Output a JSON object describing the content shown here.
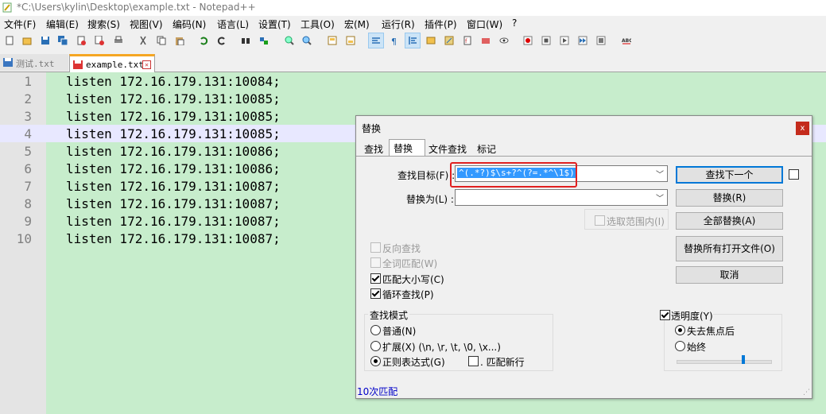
{
  "window": {
    "title": "*C:\\Users\\kylin\\Desktop\\example.txt - Notepad++"
  },
  "menu": [
    "文件(F)",
    "编辑(E)",
    "搜索(S)",
    "视图(V)",
    "编码(N)",
    "语言(L)",
    "设置(T)",
    "工具(O)",
    "宏(M)",
    "运行(R)",
    "插件(P)",
    "窗口(W)",
    "?"
  ],
  "toolbar": {
    "icons": [
      "new-file-icon",
      "open-file-icon",
      "save-icon",
      "save-all-icon",
      "close-icon",
      "close-all-icon",
      "print-icon",
      "cut-icon",
      "copy-icon",
      "paste-icon",
      "undo-icon",
      "redo-icon",
      "find-icon",
      "replace-icon",
      "zoom-in-icon",
      "zoom-out-icon",
      "sync-v-icon",
      "sync-h-icon",
      "word-wrap-icon",
      "all-chars-icon",
      "indent-guide-icon",
      "udl-icon",
      "doc-map-icon",
      "function-list-icon",
      "folder-as-workspace-icon",
      "monitor-icon",
      "record-macro-icon",
      "stop-record-icon",
      "play-macro-icon",
      "run-macro-multi-icon",
      "save-macro-icon",
      "spellcheck-icon"
    ]
  },
  "tabs": [
    {
      "label": "测试.txt",
      "active": false
    },
    {
      "label": "example.txt",
      "active": true
    }
  ],
  "editor": {
    "current_line": 4,
    "lines": [
      "listen 172.16.179.131:10084;",
      "listen 172.16.179.131:10085;",
      "listen 172.16.179.131:10085;",
      "listen 172.16.179.131:10085;",
      "listen 172.16.179.131:10086;",
      "listen 172.16.179.131:10086;",
      "listen 172.16.179.131:10087;",
      "listen 172.16.179.131:10087;",
      "listen 172.16.179.131:10087;",
      "listen 172.16.179.131:10087;"
    ],
    "background_color": "#c7edcc"
  },
  "dialog": {
    "title": "替换",
    "close_label": "x",
    "tabs": [
      "查找",
      "替换",
      "文件查找",
      "标记"
    ],
    "active_tab": "替换",
    "find_label": "查找目标(F) :",
    "find_value": "^(.*?)$\\s+?^(?=.*^\\1$)",
    "replace_label": "替换为(L) :",
    "replace_value": "",
    "in_selection": {
      "label": "选取范围内(I)",
      "checked": false,
      "enabled": false
    },
    "buttons": {
      "find_next": "查找下一个",
      "replace": "替换(R)",
      "replace_all": "全部替换(A)",
      "replace_all_open": "替换所有打开文件(O)",
      "cancel": "取消"
    },
    "options": {
      "backward": {
        "label": "反向查找",
        "checked": false,
        "enabled": false
      },
      "whole_word": {
        "label": "全词匹配(W)",
        "checked": false,
        "enabled": false
      },
      "match_case": {
        "label": "匹配大小写(C)",
        "checked": true,
        "enabled": true
      },
      "wrap": {
        "label": "循环查找(P)",
        "checked": true,
        "enabled": true
      }
    },
    "search_mode": {
      "title": "查找模式",
      "normal": "普通(N)",
      "extended": "扩展(X) (\\n, \\r, \\t, \\0, \\x...)",
      "regex": "正则表达式(G)",
      "selected": "regex",
      "dot_newline": {
        "label": ". 匹配新行",
        "checked": false
      }
    },
    "transparency": {
      "label": "透明度(Y)",
      "checked": true,
      "on_lose_focus": "失去焦点后",
      "always": "始终",
      "selected": "on_lose_focus",
      "slider_level": 0.7
    },
    "status": "10次匹配"
  },
  "colors": {
    "highlight_border": "#e02020",
    "current_line": "#e8e8ff",
    "status_text": "#0000c8"
  }
}
